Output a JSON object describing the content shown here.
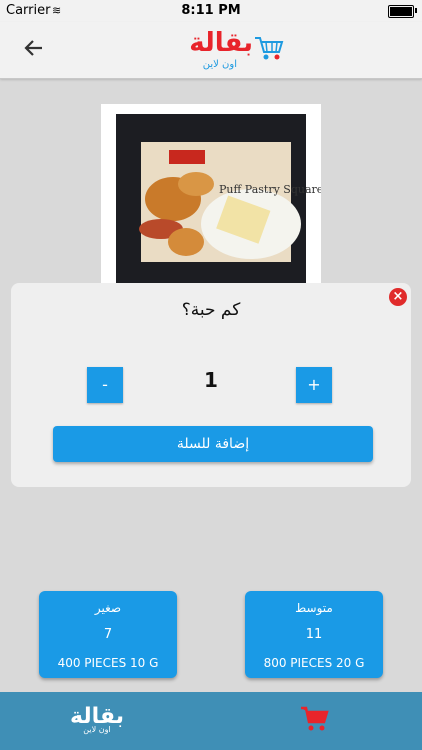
{
  "status": {
    "carrier": "Carrier",
    "time": "8:11 PM"
  },
  "logo": {
    "title": "بقالة",
    "subtitle": "اون لاين"
  },
  "popup": {
    "question": "كم حبة؟",
    "minus_label": "-",
    "plus_label": "+",
    "quantity": "1",
    "add_to_cart_label": "إضافة للسلة",
    "close_label": "×"
  },
  "sizes": [
    {
      "name": "صغير",
      "price": "7",
      "description": "400 PIECES 10 G"
    },
    {
      "name": "متوسط",
      "price": "11",
      "description": "800 PIECES 20 G"
    }
  ],
  "product": {
    "package_text": "Puff Pastry Squares"
  },
  "colors": {
    "accent": "#1a9ae6",
    "bottom_bar": "#3f8fb6",
    "logo_red": "#e8242b",
    "close_red": "#e02b2b"
  }
}
